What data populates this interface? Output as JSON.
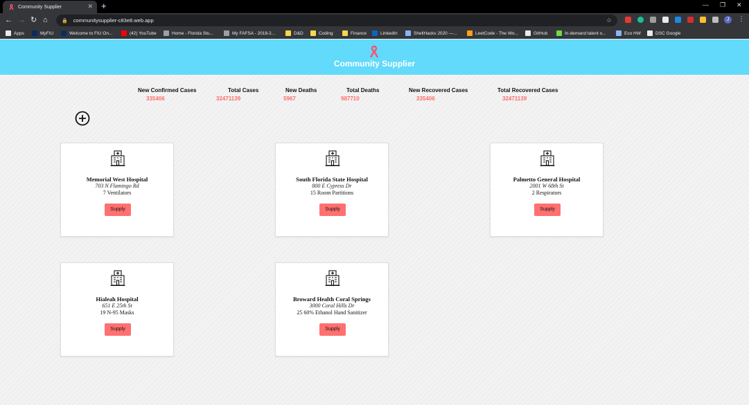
{
  "browser": {
    "tab_title": "Community Supplier",
    "url": "communitysupplier-c83e8.web.app",
    "profile_initial": "J",
    "bookmarks": [
      {
        "label": "Apps",
        "icon": "apps-grid-icon",
        "color": "#e8eaed"
      },
      {
        "label": "MyFIU",
        "icon": "fiu-icon",
        "color": "#0b2c5f"
      },
      {
        "label": "Welcome to FIU On...",
        "icon": "fiu-icon",
        "color": "#0b2c5f"
      },
      {
        "label": "(42) YouTube",
        "icon": "youtube-icon",
        "color": "#ff0000"
      },
      {
        "label": "Home - Florida Stu...",
        "icon": "globe-icon",
        "color": "#9aa0a6"
      },
      {
        "label": "My FAFSA - 2018-2...",
        "icon": "globe-icon",
        "color": "#9aa0a6"
      },
      {
        "label": "D&D",
        "icon": "folder-icon",
        "color": "#f9d84a"
      },
      {
        "label": "Coding",
        "icon": "folder-icon",
        "color": "#f9d84a"
      },
      {
        "label": "Finance",
        "icon": "folder-icon",
        "color": "#f9d84a"
      },
      {
        "label": "LinkedIn",
        "icon": "linkedin-icon",
        "color": "#0a66c2"
      },
      {
        "label": "ShellHacks 2020 —...",
        "icon": "shellhacks-icon",
        "color": "#8ab4f8"
      },
      {
        "label": "LeetCode - The Wo...",
        "icon": "leetcode-icon",
        "color": "#ffa116"
      },
      {
        "label": "GitHub",
        "icon": "github-icon",
        "color": "#e8eaed"
      },
      {
        "label": "In-demand talent o...",
        "icon": "upwork-icon",
        "color": "#6fda44"
      },
      {
        "label": "Eco HW",
        "icon": "s-icon",
        "color": "#8ab4f8"
      },
      {
        "label": "DSC Google",
        "icon": "dsc-icon",
        "color": "#e8eaed"
      }
    ]
  },
  "app": {
    "title": "Community Supplier",
    "accent_color": "#61dafb",
    "highlight_color": "#ff6b6b"
  },
  "stats": [
    {
      "label": "New Confirmed Cases",
      "value": "335406"
    },
    {
      "label": "Total Cases",
      "value": "32471139"
    },
    {
      "label": "New Deaths",
      "value": "5967"
    },
    {
      "label": "Total Deaths",
      "value": "987710"
    },
    {
      "label": "New Recovered Cases",
      "value": "335406"
    },
    {
      "label": "Total Recovered Cases",
      "value": "32471139"
    }
  ],
  "cards": [
    {
      "name": "Memorial West Hospital",
      "address": "703 N Flamingo Rd",
      "need": "7 Ventilators",
      "button": "Supply"
    },
    {
      "name": "South Florida State Hospital",
      "address": "800 E Cypress Dr",
      "need": "15 Room Partitions",
      "button": "Supply"
    },
    {
      "name": "Palmetto General Hospital",
      "address": "2001 W 68th St",
      "need": "2 Respirators",
      "button": "Supply"
    },
    {
      "name": "Hialeah Hospital",
      "address": "651 E 25th St",
      "need": "19 N-95 Masks",
      "button": "Supply"
    },
    {
      "name": "Broward Health Coral Springs",
      "address": "3000 Coral Hills Dr",
      "need": "25 60% Ethanol Hand Sanitizer",
      "button": "Supply"
    }
  ]
}
